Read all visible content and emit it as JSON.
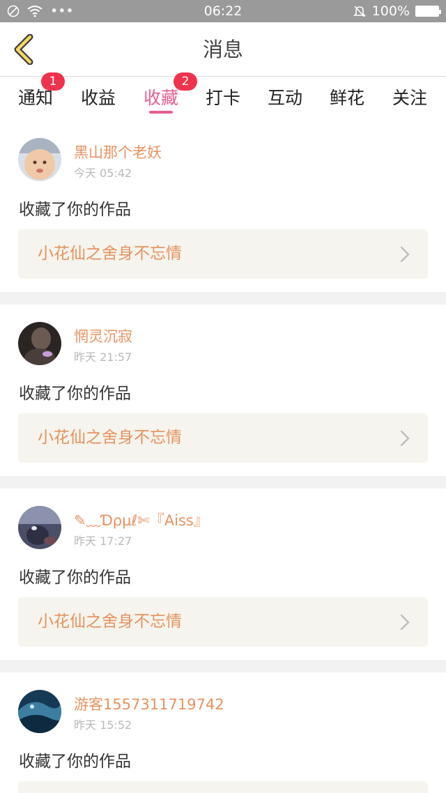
{
  "status_bar": {
    "time": "06:22",
    "dots": "•••",
    "battery": "100%"
  },
  "header": {
    "title": "消息",
    "back_icon": "chevron-left-icon"
  },
  "tabs": [
    {
      "label": "通知",
      "badge": "1",
      "active": false
    },
    {
      "label": "收益",
      "badge": "",
      "active": false
    },
    {
      "label": "收藏",
      "badge": "2",
      "active": true
    },
    {
      "label": "打卡",
      "badge": "",
      "active": false
    },
    {
      "label": "互动",
      "badge": "",
      "active": false
    },
    {
      "label": "鲜花",
      "badge": "",
      "active": false
    },
    {
      "label": "关注",
      "badge": "",
      "active": false
    }
  ],
  "colors": {
    "accent": "#e85d91",
    "name": "#e7925e",
    "badge": "#f0334c"
  },
  "items": [
    {
      "username": "黑山那个老妖",
      "time": "今天 05:42",
      "action": "收藏了你的作品",
      "work": "小花仙之舍身不忘情"
    },
    {
      "username": "惘灵沉寂",
      "time": "昨天 21:57",
      "action": "收藏了你的作品",
      "work": "小花仙之舍身不忘情"
    },
    {
      "username": "✎﹏Ɗρµℓ✄『Aiss』",
      "time": "昨天 17:27",
      "action": "收藏了你的作品",
      "work": "小花仙之舍身不忘情"
    },
    {
      "username": "游客1557311719742",
      "time": "昨天 15:52",
      "action": "收藏了你的作品",
      "work": ""
    }
  ]
}
